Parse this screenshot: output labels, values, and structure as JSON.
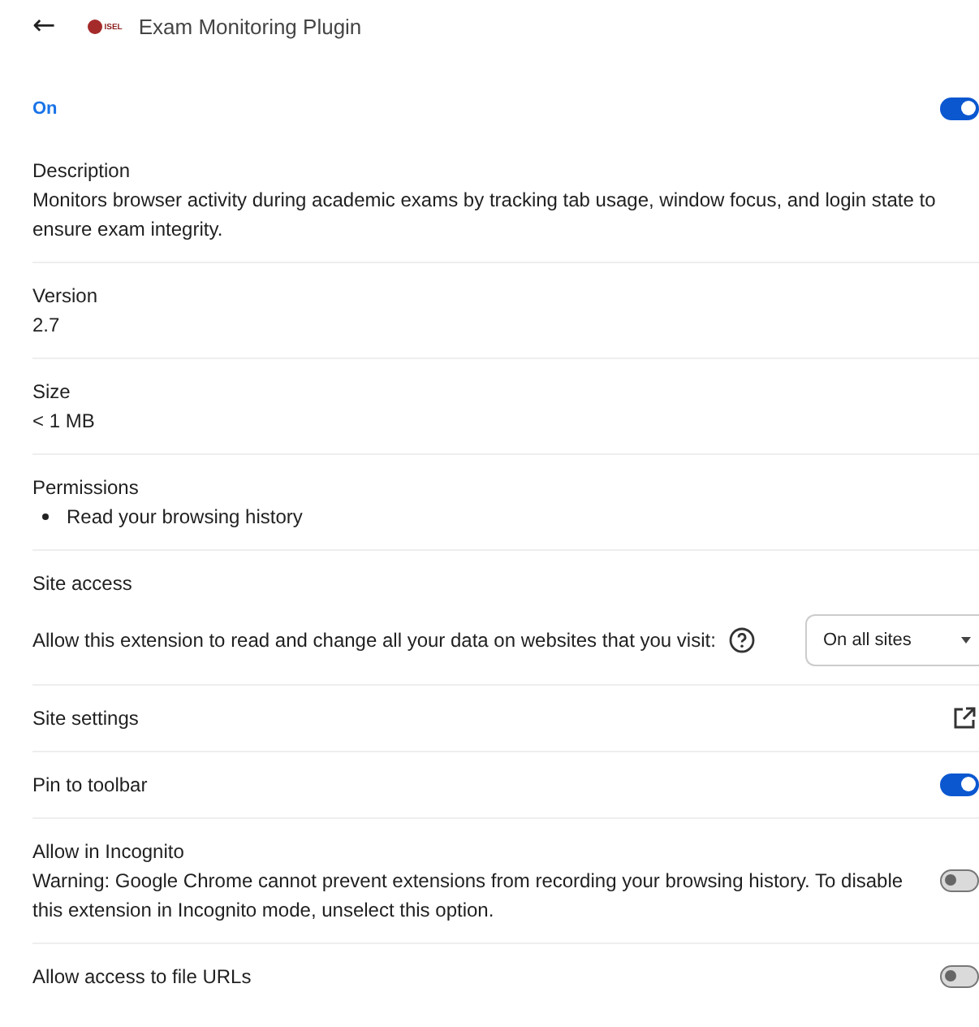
{
  "header": {
    "back": "←",
    "logo_text": "ISEL",
    "title": "Exam Monitoring Plugin"
  },
  "enabled": {
    "label": "On",
    "on": true
  },
  "rows": [
    {
      "kind": "info",
      "label": "Description",
      "text": "Monitors browser activity during academic exams by tracking tab usage, window focus, and login state to ensure exam integrity."
    },
    {
      "kind": "info",
      "label": "Version",
      "text": "2.7"
    },
    {
      "kind": "info",
      "label": "Size",
      "text": "< 1 MB"
    },
    {
      "kind": "list",
      "label": "Permissions",
      "items": [
        "Read your browsing history"
      ]
    },
    {
      "kind": "access",
      "label": "Site access",
      "text": "Allow this extension to read and change all your data on websites that you visit:",
      "value": "On all sites"
    },
    {
      "kind": "link",
      "label": "Site settings"
    },
    {
      "kind": "toggle",
      "label": "Pin to toolbar",
      "on": true
    },
    {
      "kind": "toggle",
      "label": "Allow in Incognito",
      "text": "Warning: Google Chrome cannot prevent extensions from recording your browsing history. To disable this extension in Incognito mode, unselect this option.",
      "on": false
    },
    {
      "kind": "toggle",
      "label": "Allow access to file URLs",
      "on": false
    }
  ]
}
